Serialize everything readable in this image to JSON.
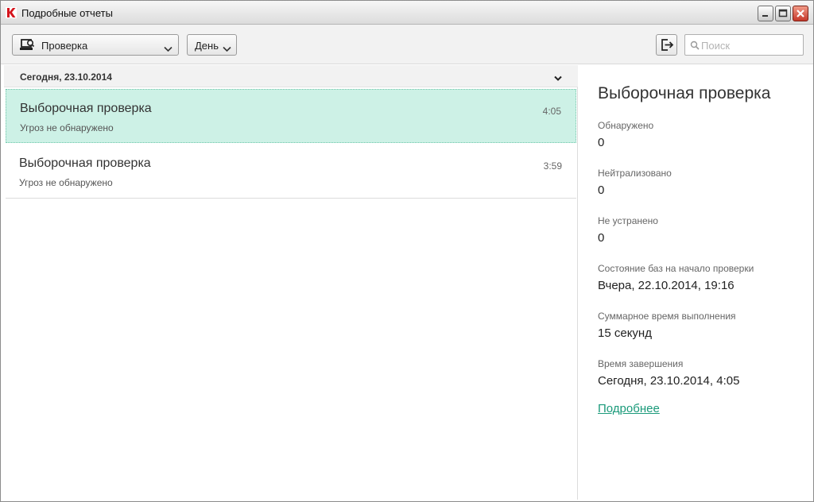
{
  "window": {
    "title": "Подробные отчеты"
  },
  "toolbar": {
    "type_dropdown": {
      "selected": "Проверка",
      "icon": "scan-computer-icon"
    },
    "period_dropdown": {
      "selected": "День"
    },
    "export_icon": "export-icon",
    "search": {
      "placeholder": "Поиск",
      "value": ""
    }
  },
  "list": {
    "group_title": "Сегодня, 23.10.2014",
    "items": [
      {
        "title": "Выборочная проверка",
        "status": "Угроз не обнаружено",
        "time": "4:05",
        "selected": true
      },
      {
        "title": "Выборочная проверка",
        "status": "Угроз не обнаружено",
        "time": "3:59",
        "selected": false
      }
    ]
  },
  "detail": {
    "title": "Выборочная проверка",
    "fields": [
      {
        "label": "Обнаружено",
        "value": "0"
      },
      {
        "label": "Нейтрализовано",
        "value": "0"
      },
      {
        "label": "Не устранено",
        "value": "0"
      },
      {
        "label": "Состояние баз на начало проверки",
        "value": "Вчера, 22.10.2014, 19:16"
      },
      {
        "label": "Суммарное время выполнения",
        "value": "15 секунд"
      },
      {
        "label": "Время завершения",
        "value": "Сегодня, 23.10.2014, 4:05"
      }
    ],
    "more_link": "Подробнее"
  },
  "colors": {
    "accent": "#1a9a7a",
    "selection": "#cdf1e6",
    "close_button": "#c6382a"
  }
}
